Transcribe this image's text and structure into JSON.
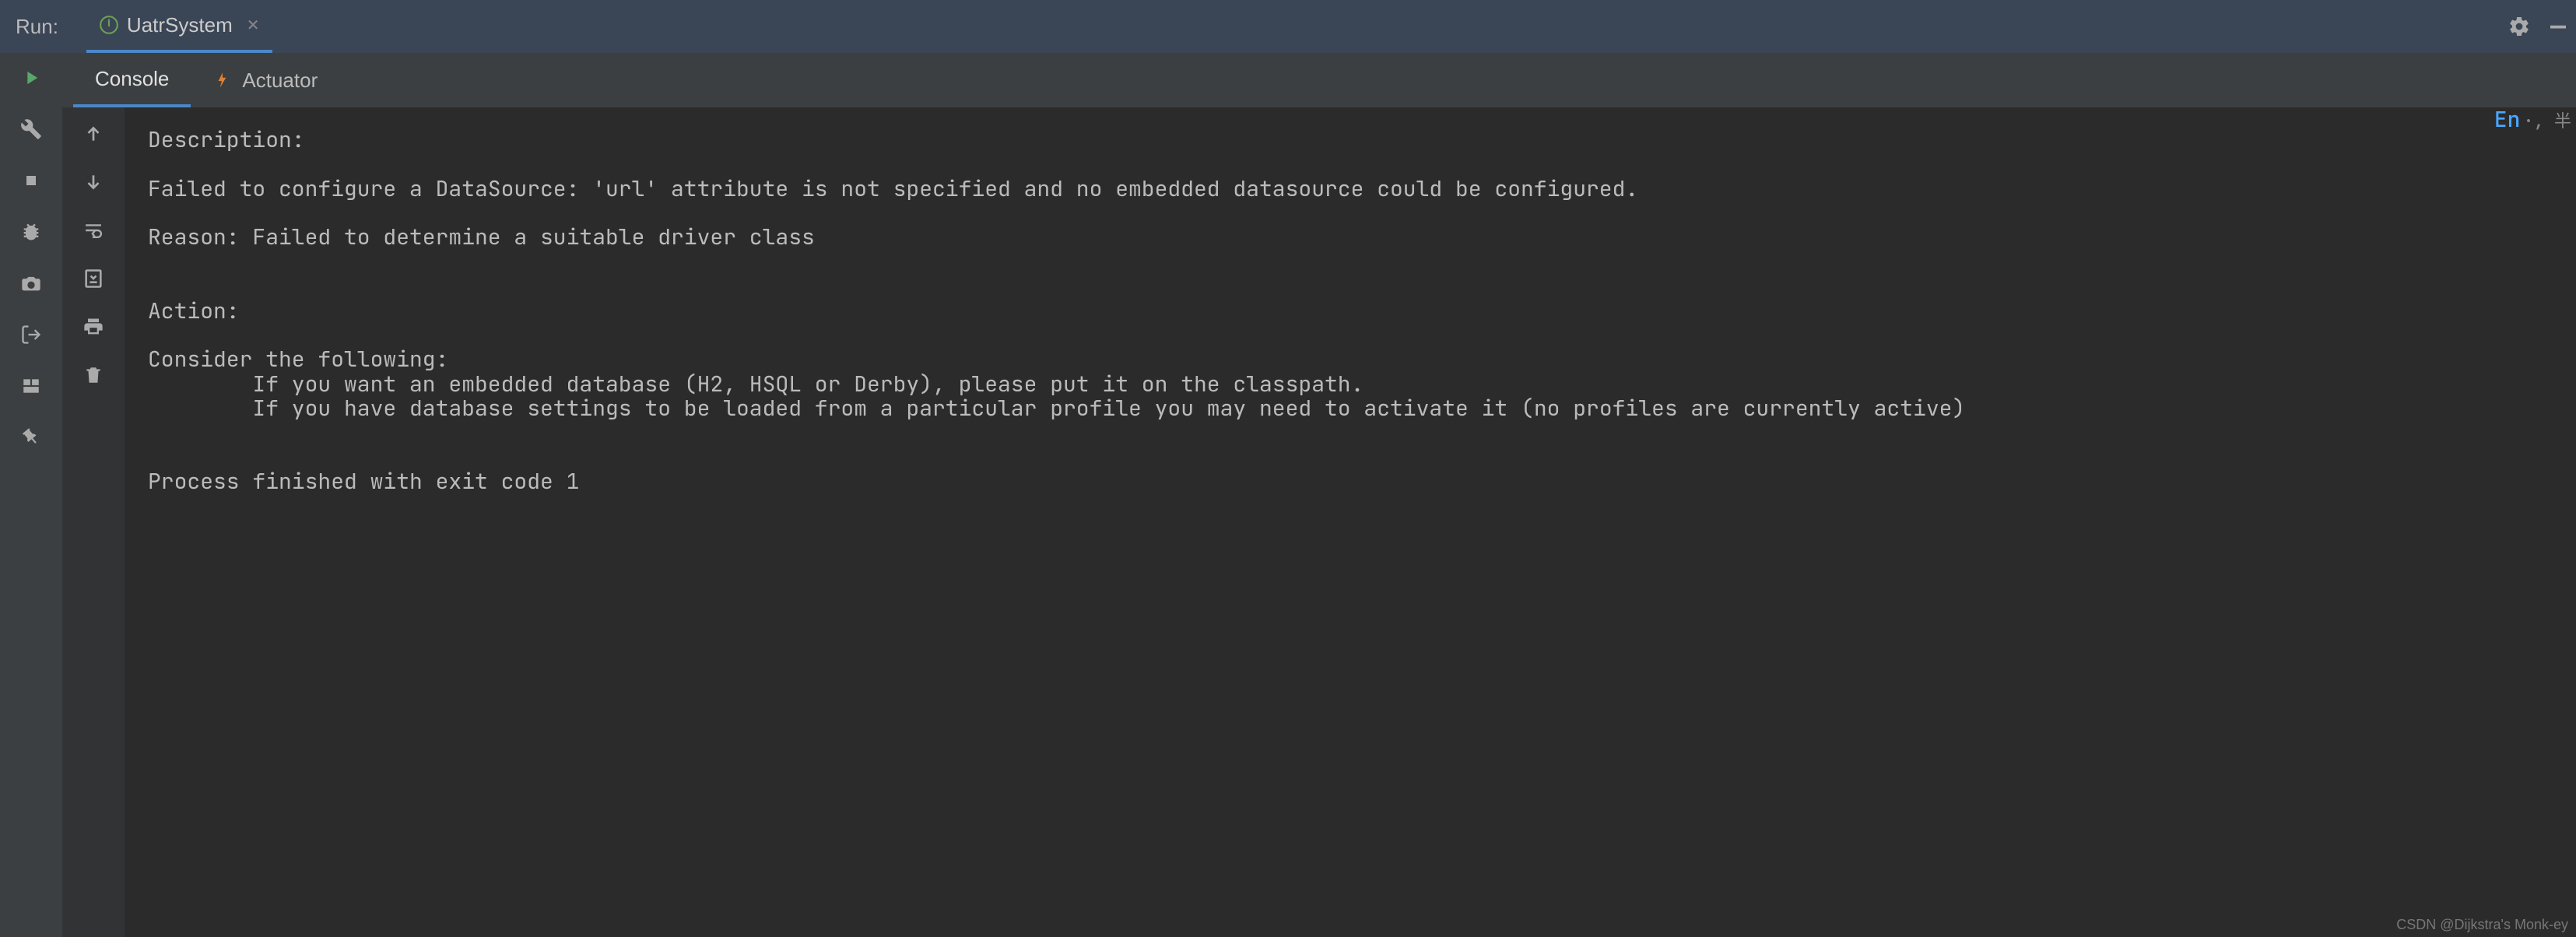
{
  "header": {
    "run_label": "Run:",
    "config_name": "UatrSystem"
  },
  "tabs": {
    "console": "Console",
    "actuator": "Actuator"
  },
  "ime": {
    "lang": "En",
    "suffix": "·, 半"
  },
  "console": {
    "lines": [
      "Description:",
      "",
      "Failed to configure a DataSource: 'url' attribute is not specified and no embedded datasource could be configured.",
      "",
      "Reason: Failed to determine a suitable driver class",
      "",
      "",
      "Action:",
      "",
      "Consider the following:",
      "\tIf you want an embedded database (H2, HSQL or Derby), please put it on the classpath.",
      "\tIf you have database settings to be loaded from a particular profile you may need to activate it (no profiles are currently active)",
      "",
      "",
      "Process finished with exit code 1"
    ]
  },
  "watermark": "CSDN @Dijkstra's Monk-ey"
}
